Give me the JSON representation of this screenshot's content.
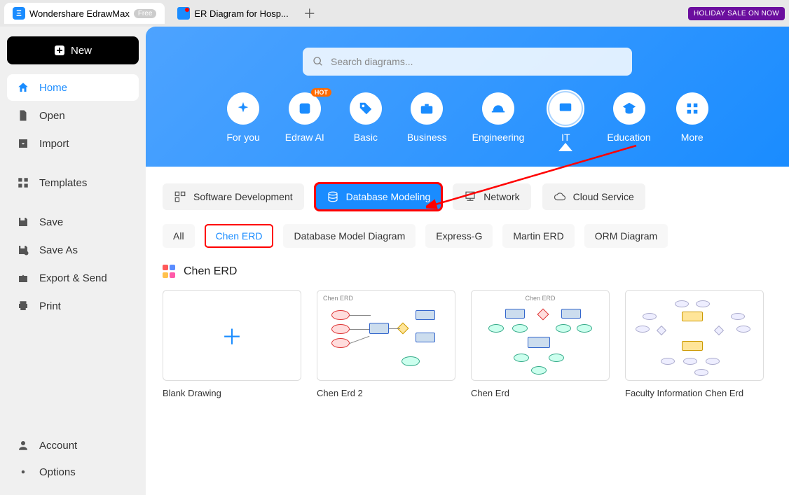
{
  "tabs": [
    {
      "title": "Wondershare EdrawMax",
      "badge": "Free",
      "icon": "app"
    },
    {
      "title": "ER Diagram for Hosp...",
      "icon": "doc"
    }
  ],
  "holiday_label": "HOLIDAY SALE ON NOW",
  "sidebar": {
    "new_label": "New",
    "items": [
      {
        "label": "Home",
        "icon": "home"
      },
      {
        "label": "Open",
        "icon": "open"
      },
      {
        "label": "Import",
        "icon": "import"
      }
    ],
    "tools": [
      {
        "label": "Templates",
        "icon": "templates"
      }
    ],
    "file_ops": [
      {
        "label": "Save",
        "icon": "save"
      },
      {
        "label": "Save As",
        "icon": "saveas"
      },
      {
        "label": "Export & Send",
        "icon": "export"
      },
      {
        "label": "Print",
        "icon": "print"
      }
    ],
    "bottom": [
      {
        "label": "Account",
        "icon": "account"
      },
      {
        "label": "Options",
        "icon": "options"
      }
    ]
  },
  "search": {
    "placeholder": "Search diagrams..."
  },
  "categories": [
    {
      "label": "For you"
    },
    {
      "label": "Edraw AI",
      "hot": "HOT"
    },
    {
      "label": "Basic"
    },
    {
      "label": "Business"
    },
    {
      "label": "Engineering"
    },
    {
      "label": "IT",
      "selected": true
    },
    {
      "label": "Education"
    },
    {
      "label": "More"
    }
  ],
  "sub_tabs": [
    {
      "label": "Software Development"
    },
    {
      "label": "Database Modeling",
      "active": true,
      "highlighted": true
    },
    {
      "label": "Network"
    },
    {
      "label": "Cloud Service"
    }
  ],
  "filters": [
    {
      "label": "All"
    },
    {
      "label": "Chen ERD",
      "selected": true
    },
    {
      "label": "Database Model Diagram"
    },
    {
      "label": "Express-G"
    },
    {
      "label": "Martin ERD"
    },
    {
      "label": "ORM Diagram"
    }
  ],
  "section_title": "Chen ERD",
  "templates": [
    {
      "name": "Blank Drawing",
      "blank": true
    },
    {
      "name": "Chen Erd 2"
    },
    {
      "name": "Chen Erd"
    },
    {
      "name": "Faculty Information Chen Erd"
    }
  ]
}
